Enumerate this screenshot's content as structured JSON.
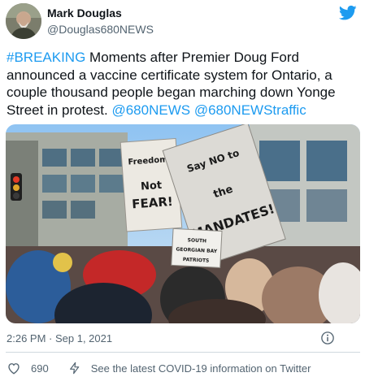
{
  "author": {
    "name": "Mark Douglas",
    "handle": "@Douglas680NEWS"
  },
  "tweet": {
    "hashtag": "#BREAKING",
    "body": " Moments after Premier Doug Ford announced a vaccine certificate system for Ontario, a couple thousand people began marching down Yonge Street in protest. ",
    "mention_1": "@680NEWS",
    "space": " ",
    "mention_2": "@680NEWStraffic"
  },
  "media": {
    "sign_1": "Freedom, Not FEAR!",
    "sign_2": "Say NO to the MANDATES!",
    "sign_3": "SOUTH GEORGIAN BAY PATRIOTS"
  },
  "meta": {
    "timestamp": "2:26 PM · Sep 1, 2021"
  },
  "actions": {
    "like_count": "690",
    "covid_link": "See the latest COVID-19 information on Twitter"
  },
  "colors": {
    "accent": "#1d9bf0",
    "text": "#0f1419",
    "secondary": "#536471",
    "divider": "#cfd9de"
  }
}
